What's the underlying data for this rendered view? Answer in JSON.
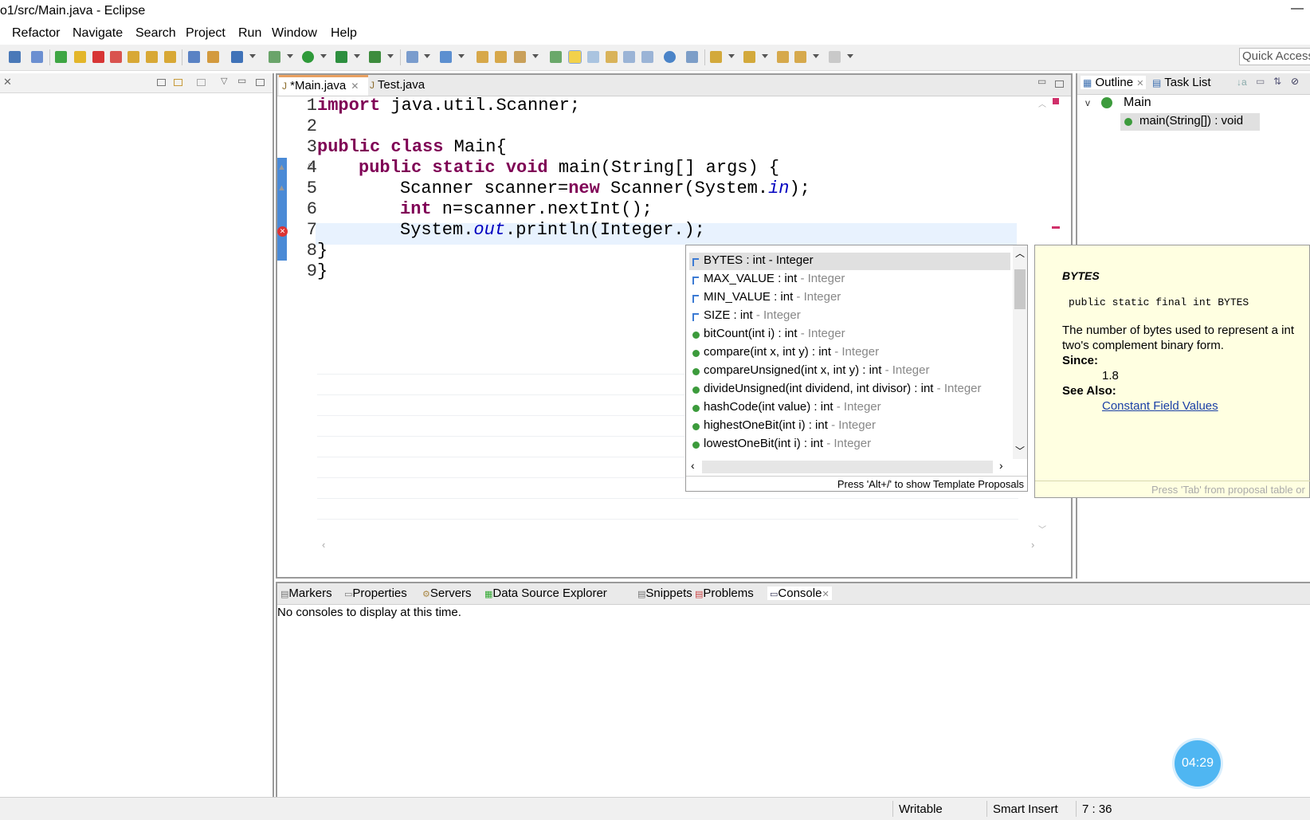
{
  "window": {
    "title": "o1/src/Main.java - Eclipse",
    "min_glyph": "—"
  },
  "menu": [
    "Refactor",
    "Navigate",
    "Search",
    "Project",
    "Run",
    "Window",
    "Help"
  ],
  "toolbar": {
    "quick_access": "Quick Access"
  },
  "editor": {
    "tabs": [
      {
        "label": "*Main.java",
        "active": true
      },
      {
        "label": "Test.java",
        "active": false
      }
    ],
    "line_numbers": [
      "1",
      "2",
      "3",
      "4",
      "5",
      "6",
      "7",
      "8",
      "9"
    ],
    "code": {
      "l1_kw": "import",
      "l1_rest": " java.util.Scanner;",
      "l3_kw": "public class",
      "l3_rest": " Main{",
      "l4_kw": "public static void",
      "l4_rest": " main(String[] args) {",
      "l5_a": "Scanner scanner=",
      "l5_kw": "new",
      "l5_b": " Scanner(System.",
      "l5_fld": "in",
      "l5_c": ");",
      "l6_kw": "int",
      "l6_rest": " n=scanner.nextInt();",
      "l7_a": "System.",
      "l7_fld": "out",
      "l7_b": ".println(Integer.);",
      "l8": "}",
      "l9": "}"
    }
  },
  "outline": {
    "tabs": [
      {
        "label": "Outline"
      },
      {
        "label": "Task List"
      }
    ],
    "class_name": "Main",
    "method": "main(String[]) : void"
  },
  "assist": {
    "proposals": [
      {
        "name": "BYTES : int",
        "type": " - Integer",
        "kind": "field"
      },
      {
        "name": "MAX_VALUE : int",
        "type": " - Integer",
        "kind": "field"
      },
      {
        "name": "MIN_VALUE : int",
        "type": " - Integer",
        "kind": "field"
      },
      {
        "name": "SIZE : int",
        "type": " - Integer",
        "kind": "field"
      },
      {
        "name": "bitCount(int i) : int",
        "type": " - Integer",
        "kind": "method"
      },
      {
        "name": "compare(int x, int y) : int",
        "type": " - Integer",
        "kind": "method"
      },
      {
        "name": "compareUnsigned(int x, int y) : int",
        "type": " - Integer",
        "kind": "method"
      },
      {
        "name": "divideUnsigned(int dividend, int divisor) : int",
        "type": " - Integer",
        "kind": "method"
      },
      {
        "name": "hashCode(int value) : int",
        "type": " - Integer",
        "kind": "method"
      },
      {
        "name": "highestOneBit(int i) : int",
        "type": " - Integer",
        "kind": "method"
      },
      {
        "name": "lowestOneBit(int i) : int",
        "type": " - Integer",
        "kind": "method"
      }
    ],
    "footer": "Press 'Alt+/' to show Template Proposals"
  },
  "doc": {
    "title": "BYTES",
    "signature": "public static final int BYTES",
    "description_1": "The number of bytes used to represent a int",
    "description_2": "two's complement binary form.",
    "since_label": "Since:",
    "since_value": "1.8",
    "see_also_label": "See Also:",
    "see_also_link": "Constant Field Values",
    "footer": "Press 'Tab' from proposal table or"
  },
  "bottom": {
    "tabs": [
      "Markers",
      "Properties",
      "Servers",
      "Data Source Explorer",
      "Snippets",
      "Problems",
      "Console"
    ],
    "message": "No consoles to display at this time."
  },
  "status": {
    "writable": "Writable",
    "insert_mode": "Smart Insert",
    "position": "7 : 36"
  },
  "timer": "04:29"
}
